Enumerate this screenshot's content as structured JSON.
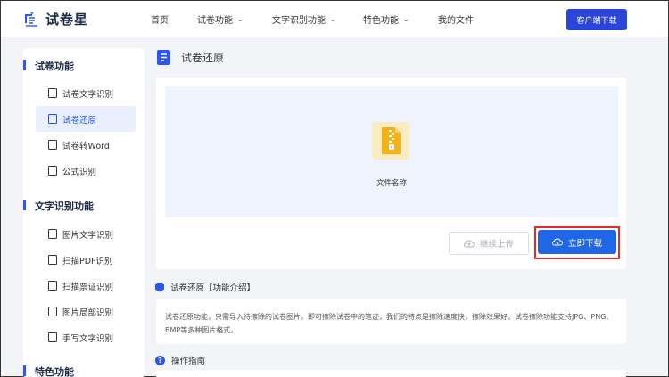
{
  "header": {
    "logo_text": "试卷星",
    "nav": {
      "home": "首页",
      "exam_functions": "试卷功能",
      "ocr_functions": "文字识别功能",
      "special_functions": "特色功能",
      "my_files": "我的文件"
    },
    "download_client": "客户端下载"
  },
  "sidebar": {
    "section_exam": "试卷功能",
    "items_exam": [
      "试卷文字识别",
      "试卷还原",
      "试卷转Word",
      "公式识别"
    ],
    "section_ocr": "文字识别功能",
    "items_ocr": [
      "图片文字识别",
      "扫描PDF识别",
      "扫描票证识别",
      "图片局部识别",
      "手写文字识别"
    ],
    "section_special": "特色功能",
    "active_item": "试卷还原"
  },
  "main": {
    "title": "试卷还原",
    "file_name": "文件名称",
    "continue_upload": "继续上传",
    "download_now": "立即下载",
    "intro_title": "试卷还原【功能介绍】",
    "intro_text": "试卷还原功能，只需导入待擦除的试卷图片，即可擦除试卷中的笔迹，我们的特点是擦除速度快，擦除效果好。试卷擦除功能支持JPG、PNG、BMP等多种图片格式。",
    "guide_title": "操作指南"
  },
  "colors": {
    "accent": "#2b56f5",
    "primary_button": "#2266e8",
    "highlight_border": "#e22a2a",
    "file_icon": "#f2b318"
  }
}
